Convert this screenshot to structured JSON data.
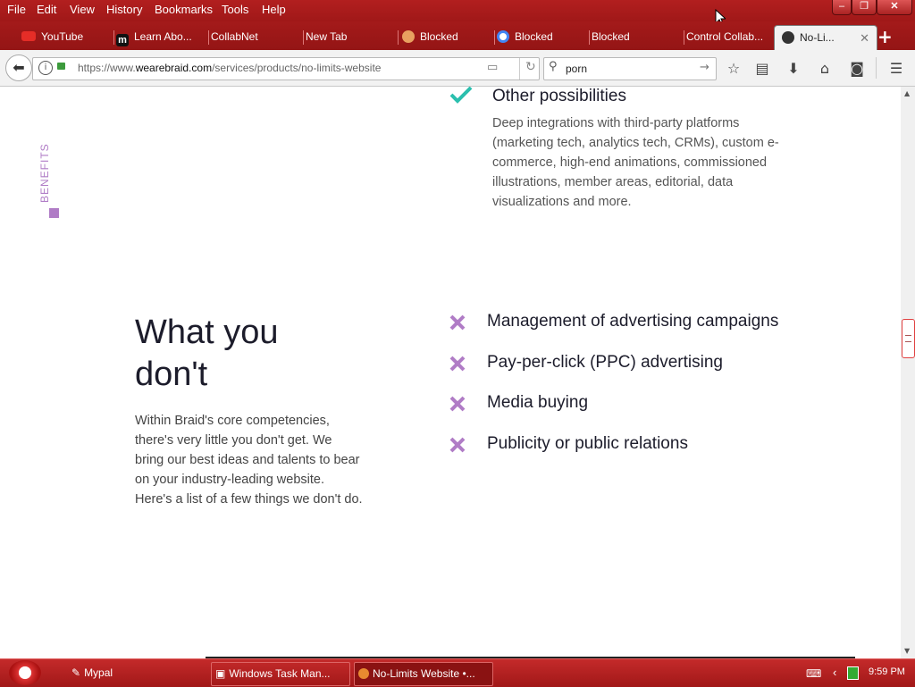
{
  "menu": {
    "file": "File",
    "edit": "Edit",
    "view": "View",
    "history": "History",
    "bookmarks": "Bookmarks",
    "tools": "Tools",
    "help": "Help"
  },
  "tabs": [
    {
      "label": "YouTube"
    },
    {
      "label": "Learn Abo..."
    },
    {
      "label": "CollabNet"
    },
    {
      "label": "New Tab"
    },
    {
      "label": "Blocked"
    },
    {
      "label": "Blocked"
    },
    {
      "label": "Blocked"
    },
    {
      "label": "Control Collab..."
    },
    {
      "label": "No-Li..."
    }
  ],
  "address": {
    "prefix": "https://www.",
    "domain": "wearebraid.com",
    "path": "/services/products/no-limits-website"
  },
  "search": {
    "value": "porn"
  },
  "page": {
    "benefits_label": "BENEFITS",
    "other_title": "Other possibilities",
    "other_body": "Deep integrations with third-party platforms (marketing tech, analytics tech, CRMs), custom e-commerce, high-end animations, commissioned illustrations, member areas, editorial, data visualizations and more.",
    "heading_line1": "What you",
    "heading_line2": "don't",
    "intro": "Within Braid's core competencies, there's very little you don't get. We bring our best ideas and talents to bear on your industry-leading website. Here's a list of a few things we don't do.",
    "dont_items": [
      "Management of advertising campaigns",
      "Pay-per-click (PPC) advertising",
      "Media buying",
      "Publicity or public relations"
    ]
  },
  "taskbar": {
    "items": [
      "Mypal",
      "Windows Task Man...",
      "No-Limits Website •..."
    ],
    "clock": "9:59 PM"
  },
  "colors": {
    "accent_teal": "#2bbfae",
    "accent_purple": "#b07cc6",
    "chrome_red": "#a41a1a"
  }
}
